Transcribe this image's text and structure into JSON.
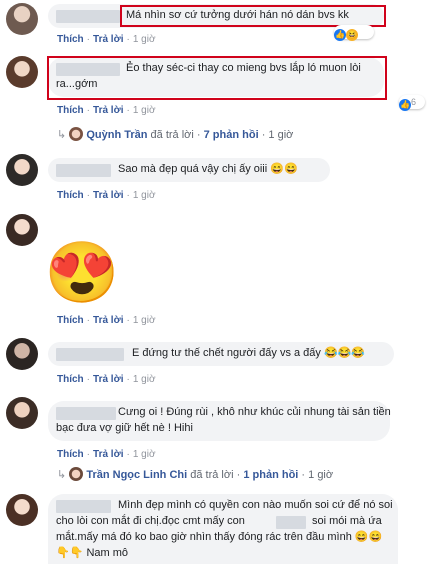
{
  "actions": {
    "like": "Thích",
    "reply": "Trả lời",
    "sep": "·"
  },
  "comments": [
    {
      "text": "Má nhìn sơ cứ tưởng dưới hán nó dán bvs kk",
      "time": "1 giờ"
    },
    {
      "text_line1": "Ẻo thay séc-ci thay co mieng bvs lắp ló muon lòi",
      "text_line2": "ra...gớm",
      "reaction_count": "6",
      "reply_author": "Quỳnh Trần",
      "reply_mid": "đã trả lời",
      "reply_count": "7 phản hồi",
      "reply_time": "1 giờ"
    },
    {
      "text": "Sao mà đẹp quá vậy chị ấy oiii",
      "emoji": "😄😄",
      "time": "1 giờ"
    },
    {
      "sticker": "😍",
      "time": "1 giờ"
    },
    {
      "text": "E đứng tư thế chết người đấy vs a đấy",
      "emoji": "😂😂😂",
      "time": "1 giờ"
    },
    {
      "text_line1": "Cưng oi ! Đúng rùi , khô như khúc củi nhung tài sản tiền",
      "text_line2": "bạc đưa vợ giữ hết nè ! Hihi",
      "time": "1 giờ",
      "reply_author": "Trần Ngọc Linh Chi",
      "reply_mid": "đã trả lời",
      "reply_count": "1 phản hồi",
      "reply_time": "1 giờ"
    },
    {
      "text_line1": "Mình đẹp mình có quyền con nào muốn soi cứ để nó soi",
      "text_line2a": "cho lòi con mắt đi chị.đọc cmt mấy con",
      "text_line2b": "soi mói mà ứa",
      "text_line3": "mắt.mấy má đó ko bao giờ nhìn thấy đóng rác trên đầu mình",
      "text_line3_emoji": "😄😄",
      "text_line4_emoji": "👇👇",
      "text_line4": "Nam mô"
    }
  ]
}
